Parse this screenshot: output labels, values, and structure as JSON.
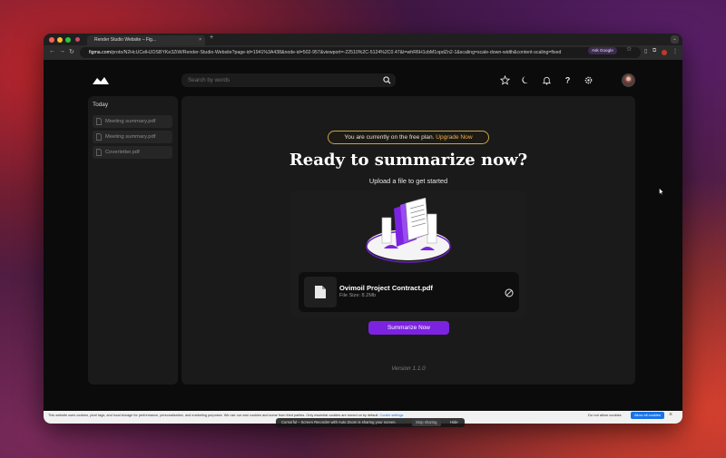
{
  "browser": {
    "tab_title": "Render Studio Website – Fig...",
    "tab_close": "×",
    "new_tab": "+",
    "url_host": "figma.com",
    "url_path": "/proto/N2HcUCelHJOSBYKe3ZiW/Render-Studio-Website?page-id=1941%3A438&node-id=502-957&viewport=-22510%2C-5124%2C0.47&t=whR6H1cbM1opdZn2-1&scaling=scale-down-width&content-scaling=fixed",
    "ask_google": "Ask Google"
  },
  "app": {
    "search_placeholder": "Search by words",
    "icons": [
      "star-icon",
      "moon-icon",
      "bell-icon",
      "help-icon",
      "gear-icon"
    ]
  },
  "sidebar": {
    "title": "Today",
    "items": [
      {
        "label": "Meeting summary.pdf"
      },
      {
        "label": "Meeting summary.pdf"
      },
      {
        "label": "Coverletter.pdf"
      }
    ]
  },
  "main": {
    "plan_text": "You are currently on the free plan.",
    "upgrade_label": "Upgrade Now",
    "title": "Ready to summarize now?",
    "subtitle": "Upload a file to get started",
    "file_name": "Ovimoil Project Contract.pdf",
    "file_size": "File Size: 8.2Mb",
    "button_label": "Summarize Now",
    "version": "Version 1.1.0"
  },
  "cookie_bar": {
    "text": "This website uses cookies, pixel tags, and local storage for performance, personalization, and marketing purposes. We use our own cookies and some from third parties. Only essential cookies are turned on by default.",
    "link": "Cookie settings",
    "deny_label": "Do not allow cookies",
    "allow_label": "Allow all cookies",
    "close": "×"
  },
  "screen_share": {
    "text": "Cursorful – Screen Recorder with Auto Zoom is sharing your screen.",
    "stop_label": "Stop sharing",
    "hide_label": "Hide"
  },
  "colors": {
    "accent": "#7b23e0",
    "banner_border": "#c9a24c",
    "upgrade": "#f0b34a",
    "page_bg": "#0b0b0b",
    "panel_bg": "#1a1a1a"
  }
}
